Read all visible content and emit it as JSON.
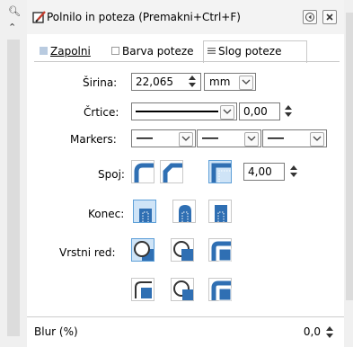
{
  "window": {
    "title": "Polnilo in poteza",
    "shortcut": "(Premakni+Ctrl+F)"
  },
  "tabs": [
    {
      "label": "Zapolni"
    },
    {
      "label": "Barva poteze"
    },
    {
      "label": "Slog poteze"
    }
  ],
  "stroke": {
    "width_label": "Širina:",
    "width_value": "22,065",
    "unit": "mm",
    "dashes_label": "Črtice:",
    "dash_offset": "0,00",
    "markers_label": "Markers:",
    "join_label": "Spoj:",
    "miter_limit": "4,00",
    "cap_label": "Konec:",
    "order_label": "Vrstni red:"
  },
  "footer": {
    "blur_label": "Blur (%)",
    "blur_value": "0,0"
  },
  "colors": {
    "selected_bg": "#cfe4f7",
    "selected_border": "#5fa0d8",
    "icon_blue": "#2f6fb3"
  }
}
